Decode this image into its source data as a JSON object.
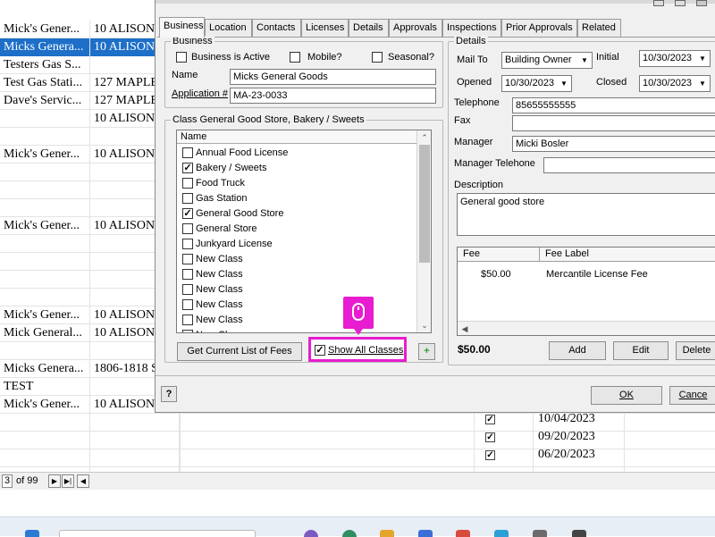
{
  "background": {
    "rows": [
      {
        "c1": "Mick's Gener...",
        "c2": "10 ALISON",
        "selected": false
      },
      {
        "c1": "Micks Genera...",
        "c2": "10 ALISON",
        "selected": true
      },
      {
        "c1": "Testers Gas S...",
        "c2": "",
        "selected": false
      },
      {
        "c1": "Test Gas Stati...",
        "c2": "127 MAPLE",
        "selected": false
      },
      {
        "c1": "Dave's Servic...",
        "c2": "127 MAPLE",
        "selected": false
      },
      {
        "c1": "",
        "c2": "10 ALISON",
        "selected": false
      },
      {
        "c1": "",
        "c2": "",
        "selected": false
      },
      {
        "c1": "Mick's Gener...",
        "c2": "10 ALISON",
        "selected": false
      },
      {
        "c1": "",
        "c2": "",
        "selected": false
      },
      {
        "c1": "",
        "c2": "",
        "selected": false
      },
      {
        "c1": "",
        "c2": "",
        "selected": false
      },
      {
        "c1": "Mick's Gener...",
        "c2": "10 ALISON",
        "selected": false
      },
      {
        "c1": "",
        "c2": "",
        "selected": false
      },
      {
        "c1": "",
        "c2": "",
        "selected": false
      },
      {
        "c1": "",
        "c2": "",
        "selected": false
      },
      {
        "c1": "",
        "c2": "",
        "selected": false
      },
      {
        "c1": "Mick's Gener...",
        "c2": "10 ALISON",
        "selected": false
      },
      {
        "c1": "Mick General...",
        "c2": "10 ALISON",
        "selected": false
      },
      {
        "c1": "",
        "c2": "",
        "selected": false
      },
      {
        "c1": "Micks Genera...",
        "c2": "1806-1818 S",
        "selected": false
      },
      {
        "c1": "TEST",
        "c2": "",
        "selected": false
      },
      {
        "c1": "Mick's Gener...",
        "c2": "10 ALISON",
        "selected": false
      },
      {
        "c1": "",
        "c2": "",
        "selected": false
      },
      {
        "c1": "",
        "c2": "",
        "selected": false
      },
      {
        "c1": "",
        "c2": "",
        "selected": false
      },
      {
        "c1": "",
        "c2": "",
        "selected": false
      }
    ],
    "dates": [
      "10/04/2023",
      "09/20/2023",
      "06/20/2023"
    ],
    "pager": {
      "page": "3",
      "of": "of 99"
    }
  },
  "dialog": {
    "tabs": [
      "Business",
      "Location",
      "Contacts",
      "Licenses",
      "Details",
      "Approvals",
      "Inspections",
      "Prior Approvals",
      "Related"
    ],
    "business": {
      "legend": "Business",
      "is_active_label": "Business is Active",
      "mobile_label": "Mobile?",
      "seasonal_label": "Seasonal?",
      "name_label": "Name",
      "name_value": "Micks General Goods",
      "application_label": "Application #",
      "application_value": "MA-23-0033"
    },
    "classes": {
      "legend": "Class General Good Store, Bakery / Sweets",
      "column": "Name",
      "items": [
        {
          "label": "Annual Food License",
          "checked": false
        },
        {
          "label": "Bakery / Sweets",
          "checked": true
        },
        {
          "label": "Food Truck",
          "checked": false
        },
        {
          "label": "Gas Station",
          "checked": false
        },
        {
          "label": "General Good Store",
          "checked": true
        },
        {
          "label": "General Store",
          "checked": false
        },
        {
          "label": "Junkyard License",
          "checked": false
        },
        {
          "label": "New Class",
          "checked": false
        },
        {
          "label": "New Class",
          "checked": false
        },
        {
          "label": "New Class",
          "checked": false
        },
        {
          "label": "New Class",
          "checked": false
        },
        {
          "label": "New Class",
          "checked": false
        },
        {
          "label": "New Class",
          "checked": false
        }
      ],
      "get_fees_label": "Get Current List of Fees",
      "show_all_label": "Show All Classes",
      "show_all_checked": true,
      "add_symbol": "+"
    },
    "details": {
      "legend": "Details",
      "mail_to_label": "Mail To",
      "mail_to_value": "Building Owner",
      "initial_label": "Initial",
      "initial_value": "10/30/2023",
      "opened_label": "Opened",
      "opened_value": "10/30/2023",
      "closed_label": "Closed",
      "closed_value": "10/30/2023",
      "telephone_label": "Telephone",
      "telephone_value": "85655555555",
      "fax_label": "Fax",
      "fax_value": "",
      "manager_label": "Manager",
      "manager_value": "Micki Bosler",
      "manager_tel_label": "Manager Telehone",
      "manager_tel_value": "",
      "description_label": "Description",
      "description_value": "General good store"
    },
    "fees": {
      "col_fee": "Fee",
      "col_label": "Fee Label",
      "rows": [
        {
          "fee": "$50.00",
          "label": "Mercantile License Fee"
        }
      ],
      "total": "$50.00",
      "add_label": "Add",
      "edit_label": "Edit",
      "delete_label": "Delete"
    },
    "footer": {
      "help_symbol": "?",
      "ok_label": "OK",
      "cancel_label": "Cance"
    }
  },
  "colors": {
    "highlight": "#e81cd0",
    "selection": "#1e6fc8"
  }
}
